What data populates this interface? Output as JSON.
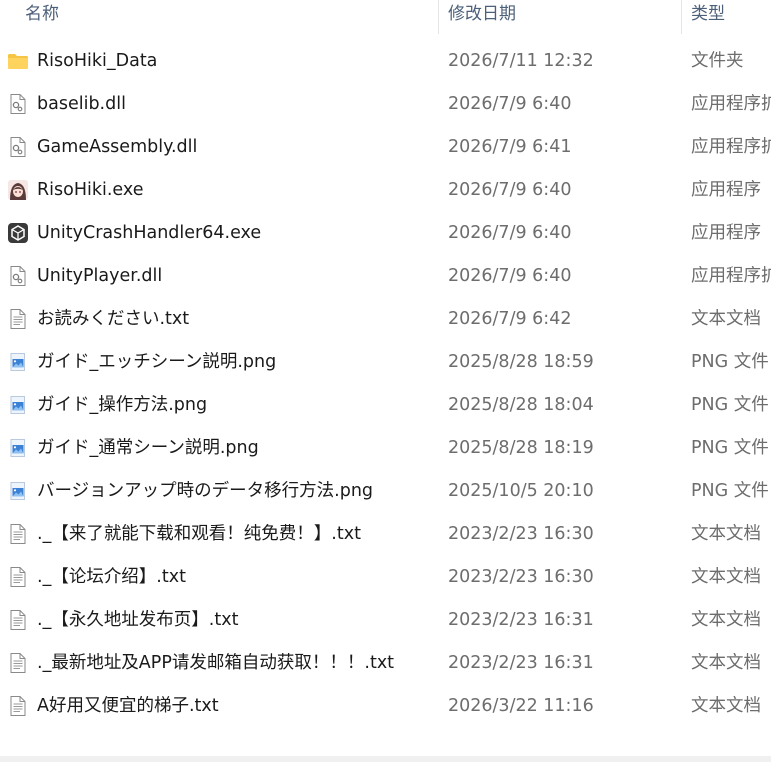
{
  "columns": {
    "name": "名称",
    "date": "修改日期",
    "type": "类型"
  },
  "files": [
    {
      "icon": "folder-icon",
      "name": "RisoHiki_Data",
      "date": "2026/7/11 12:32",
      "type": "文件夹"
    },
    {
      "icon": "dll-file-icon",
      "name": "baselib.dll",
      "date": "2026/7/9 6:40",
      "type": "应用程序扩展"
    },
    {
      "icon": "dll-file-icon",
      "name": "GameAssembly.dll",
      "date": "2026/7/9 6:41",
      "type": "应用程序扩展"
    },
    {
      "icon": "character-app-icon",
      "name": "RisoHiki.exe",
      "date": "2026/7/9 6:40",
      "type": "应用程序"
    },
    {
      "icon": "unity-app-icon",
      "name": "UnityCrashHandler64.exe",
      "date": "2026/7/9 6:40",
      "type": "应用程序"
    },
    {
      "icon": "dll-file-icon",
      "name": "UnityPlayer.dll",
      "date": "2026/7/9 6:40",
      "type": "应用程序扩展"
    },
    {
      "icon": "text-file-icon",
      "name": "お読みください.txt",
      "date": "2026/7/9 6:42",
      "type": "文本文档"
    },
    {
      "icon": "image-file-icon",
      "name": "ガイド_エッチシーン説明.png",
      "date": "2025/8/28 18:59",
      "type": "PNG 文件"
    },
    {
      "icon": "image-file-icon",
      "name": "ガイド_操作方法.png",
      "date": "2025/8/28 18:04",
      "type": "PNG 文件"
    },
    {
      "icon": "image-file-icon",
      "name": "ガイド_通常シーン説明.png",
      "date": "2025/8/28 18:19",
      "type": "PNG 文件"
    },
    {
      "icon": "image-file-icon",
      "name": "バージョンアップ時のデータ移行方法.png",
      "date": "2025/10/5 20:10",
      "type": "PNG 文件"
    },
    {
      "icon": "text-file-icon",
      "name": "._【来了就能下载和观看！纯免费！】.txt",
      "date": "2023/2/23 16:30",
      "type": "文本文档"
    },
    {
      "icon": "text-file-icon",
      "name": "._【论坛介绍】.txt",
      "date": "2023/2/23 16:30",
      "type": "文本文档"
    },
    {
      "icon": "text-file-icon",
      "name": "._【永久地址发布页】.txt",
      "date": "2023/2/23 16:31",
      "type": "文本文档"
    },
    {
      "icon": "text-file-icon",
      "name": "._最新地址及APP请发邮箱自动获取！！！.txt",
      "date": "2023/2/23 16:31",
      "type": "文本文档"
    },
    {
      "icon": "text-file-icon",
      "name": "A好用又便宜的梯子.txt",
      "date": "2026/3/22 11:16",
      "type": "文本文档"
    }
  ],
  "colors": {
    "header_text": "#4c607a",
    "name_text": "#1a1a1a",
    "meta_text": "#6d6d6d",
    "folder": "#f6c543",
    "image_icon": "#3b82d6"
  }
}
